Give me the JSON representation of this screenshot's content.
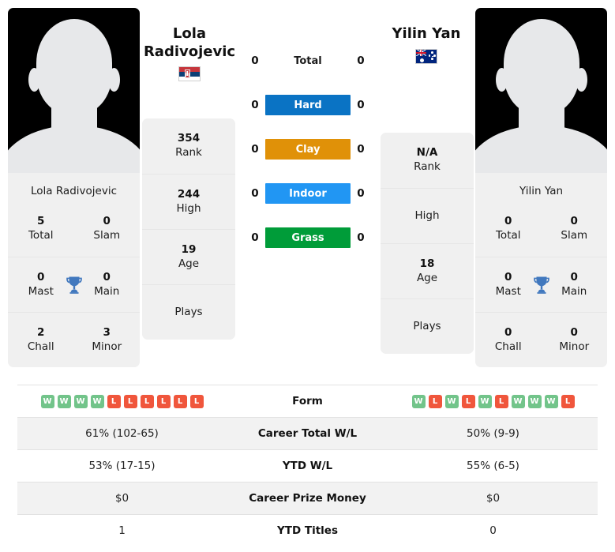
{
  "players": {
    "left": {
      "name_lines": [
        "Lola",
        "Radivojevic"
      ],
      "card_name": "Lola Radivojevic",
      "country_flag": "serbia-flag",
      "titles": {
        "total_value": "5",
        "total_label": "Total",
        "slam_value": "0",
        "slam_label": "Slam",
        "mast_value": "0",
        "mast_label": "Mast",
        "main_value": "0",
        "main_label": "Main",
        "chall_value": "2",
        "chall_label": "Chall",
        "minor_value": "3",
        "minor_label": "Minor",
        "trophy_icon": "trophy-icon"
      },
      "ranking": {
        "rank_value": "354",
        "rank_label": "Rank",
        "high_value": "244",
        "high_label": "High",
        "age_value": "19",
        "age_label": "Age",
        "plays_value": "",
        "plays_label": "Plays"
      },
      "form": [
        "W",
        "W",
        "W",
        "W",
        "L",
        "L",
        "L",
        "L",
        "L",
        "L"
      ],
      "career_total_wl": "61% (102-65)",
      "ytd_wl": "53% (17-15)",
      "career_prize_money": "$0",
      "ytd_titles": "1"
    },
    "right": {
      "name_lines": [
        "Yilin Yan"
      ],
      "card_name": "Yilin Yan",
      "country_flag": "australia-flag",
      "titles": {
        "total_value": "0",
        "total_label": "Total",
        "slam_value": "0",
        "slam_label": "Slam",
        "mast_value": "0",
        "mast_label": "Mast",
        "main_value": "0",
        "main_label": "Main",
        "chall_value": "0",
        "chall_label": "Chall",
        "minor_value": "0",
        "minor_label": "Minor",
        "trophy_icon": "trophy-icon"
      },
      "ranking": {
        "rank_value": "N/A",
        "rank_label": "Rank",
        "high_value": "",
        "high_label": "High",
        "age_value": "18",
        "age_label": "Age",
        "plays_value": "",
        "plays_label": "Plays"
      },
      "form": [
        "W",
        "L",
        "W",
        "L",
        "W",
        "L",
        "W",
        "W",
        "W",
        "L"
      ],
      "career_total_wl": "50% (9-9)",
      "ytd_wl": "55% (6-5)",
      "career_prize_money": "$0",
      "ytd_titles": "0"
    }
  },
  "head_to_head": [
    {
      "label": "Total",
      "left_score": "0",
      "right_score": "0",
      "color": "transparent",
      "plain": true
    },
    {
      "label": "Hard",
      "left_score": "0",
      "right_score": "0",
      "color": "#0a73c4",
      "plain": false
    },
    {
      "label": "Clay",
      "left_score": "0",
      "right_score": "0",
      "color": "#e09108",
      "plain": false
    },
    {
      "label": "Indoor",
      "left_score": "0",
      "right_score": "0",
      "color": "#2196f3",
      "plain": false
    },
    {
      "label": "Grass",
      "left_score": "0",
      "right_score": "0",
      "color": "#009c39",
      "plain": false
    }
  ],
  "table_labels": {
    "form": "Form",
    "career_total_wl": "Career Total W/L",
    "ytd_wl": "YTD W/L",
    "career_prize_money": "Career Prize Money",
    "ytd_titles": "YTD Titles"
  },
  "colors": {
    "win_badge": "#72c48a",
    "loss_badge": "#f0563c",
    "trophy": "#4178be",
    "panel_bg": "#f0f0f0",
    "row_shade": "#f2f2f2"
  }
}
